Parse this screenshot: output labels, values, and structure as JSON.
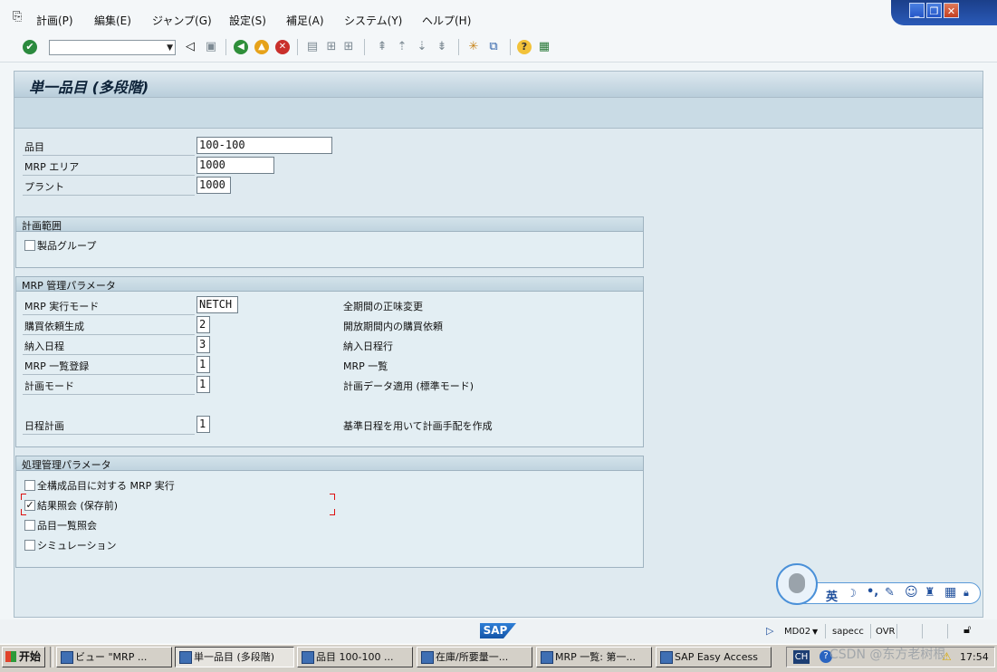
{
  "menubar": {
    "items": [
      {
        "label": "計画(P)"
      },
      {
        "label": "編集(E)"
      },
      {
        "label": "ジャンプ(G)"
      },
      {
        "label": "設定(S)"
      },
      {
        "label": "補足(A)"
      },
      {
        "label": "システム(Y)"
      },
      {
        "label": "ヘルプ(H)"
      }
    ],
    "window_controls": {
      "minimize": "_",
      "restore": "❐",
      "close": "✕"
    }
  },
  "toolbar": {
    "command_field": {
      "value": ""
    }
  },
  "screen": {
    "title": "単一品目 (多段階)"
  },
  "header_fields": {
    "material": {
      "label": "品目",
      "value": "100-100"
    },
    "mrp_area": {
      "label": "MRP エリア",
      "value": "1000"
    },
    "plant": {
      "label": "プラント",
      "value": "1000"
    }
  },
  "planning_scope": {
    "title": "計画範囲",
    "product_group": {
      "label": "製品グループ",
      "checked": false
    }
  },
  "mrp_params": {
    "title": "MRP 管理パラメータ",
    "rows": [
      {
        "label": "MRP 実行モード",
        "value": "NETCH",
        "desc": "全期間の正味変更"
      },
      {
        "label": "購買依頼生成",
        "value": "2",
        "desc": "開放期間内の購買依頼"
      },
      {
        "label": "納入日程",
        "value": "3",
        "desc": "納入日程行"
      },
      {
        "label": "MRP 一覧登録",
        "value": "1",
        "desc": "MRP 一覧"
      },
      {
        "label": "計画モード",
        "value": "1",
        "desc": "計画データ適用 (標準モード)"
      },
      {
        "label": "日程計画",
        "value": "1",
        "desc": "基準日程を用いて計画手配を作成"
      }
    ]
  },
  "process_params": {
    "title": "処理管理パラメータ",
    "items": [
      {
        "label": "全構成品目に対する MRP 実行",
        "checked": false
      },
      {
        "label": "結果照会 (保存前)",
        "checked": true
      },
      {
        "label": "品目一覧照会",
        "checked": false
      },
      {
        "label": "シミュレーション",
        "checked": false
      }
    ]
  },
  "statusbar": {
    "logo": "SAP",
    "transaction": "MD02",
    "server": "sapecc",
    "mode": "OVR"
  },
  "taskbar": {
    "start": "开始",
    "tasks": [
      {
        "label": "ビュー \"MRP ..."
      },
      {
        "label": "単一品目 (多段階)"
      },
      {
        "label": "品目 100-100 ..."
      },
      {
        "label": "在庫/所要量一..."
      },
      {
        "label": "MRP 一覧: 第一..."
      },
      {
        "label": "SAP Easy Access"
      }
    ],
    "lang": "CH",
    "clock": "17:54",
    "watermark": "CSDN @东方老树根"
  },
  "ime": {
    "lang": "英"
  },
  "colors": {
    "accent": "#1f4f9c",
    "frame": "#a9bcc8",
    "panel": "#dfeaf0"
  }
}
